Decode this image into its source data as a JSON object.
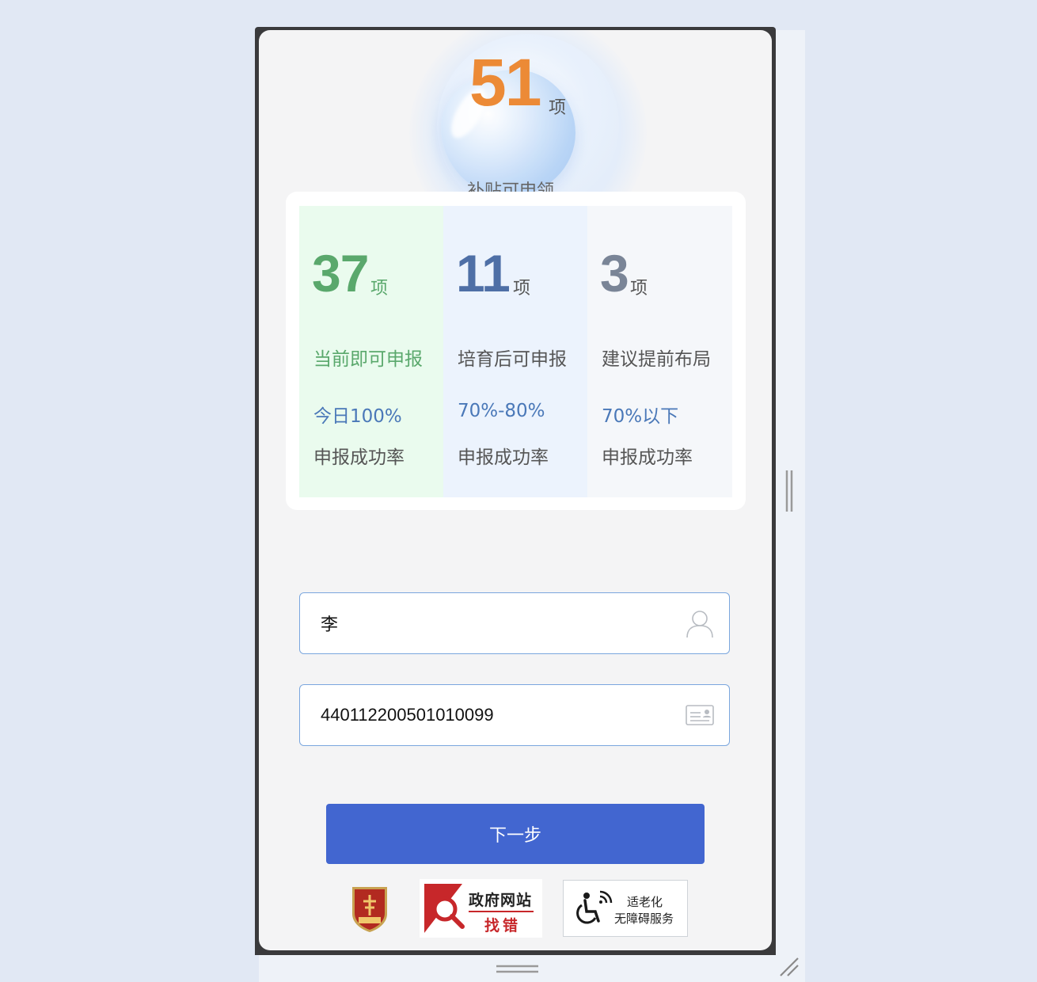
{
  "hero": {
    "count": "51",
    "unit": "项",
    "subtitle": "补贴可申领"
  },
  "stats": [
    {
      "count": "37",
      "unit": "项",
      "label": "当前即可申报",
      "rate": "今日100%",
      "rate_label": "申报成功率"
    },
    {
      "count": "11",
      "unit": "项",
      "label": "培育后可申报",
      "rate": "70%-80%",
      "rate_label": "申报成功率"
    },
    {
      "count": "3",
      "unit": "项",
      "label": "建议提前布局",
      "rate": "70%以下",
      "rate_label": "申报成功率"
    }
  ],
  "form": {
    "name_value": "李",
    "id_value": "440112200501010099"
  },
  "actions": {
    "next_label": "下一步"
  },
  "footer": {
    "find_error_line1": "政府网站",
    "find_error_line2": "找错",
    "elderly_line1": "适老化",
    "elderly_line2": "无障碍服务"
  },
  "colors": {
    "hero_accent": "#ec8a36",
    "green": "#5aa86c",
    "blue": "#4e6fa6",
    "gray": "#7a8597",
    "button": "#4266d0"
  }
}
